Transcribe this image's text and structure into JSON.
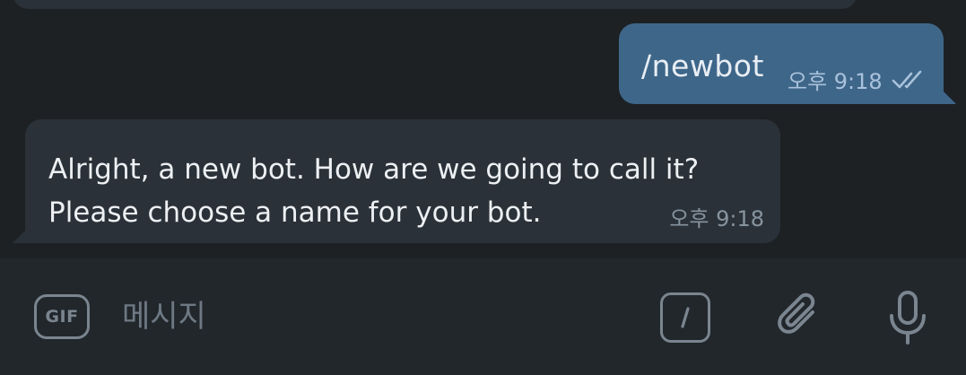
{
  "messages": {
    "outgoing": {
      "text": "/newbot",
      "time": "오후 9:18",
      "status_icon": "double-check-icon"
    },
    "incoming": {
      "line1": "Alright, a new bot. How are we going to call it?",
      "line2": "Please choose a name for your bot.",
      "time": "오후 9:18"
    }
  },
  "composer": {
    "gif_label": "GIF",
    "placeholder": "메시지",
    "command_icon": "slash-command-icon",
    "attach_icon": "paperclip-icon",
    "mic_icon": "microphone-icon"
  },
  "colors": {
    "background": "#1d2124",
    "incoming_bubble": "#2a3138",
    "outgoing_bubble": "#3e6689",
    "composer_bg": "#22272c",
    "icon": "#7a858f"
  }
}
